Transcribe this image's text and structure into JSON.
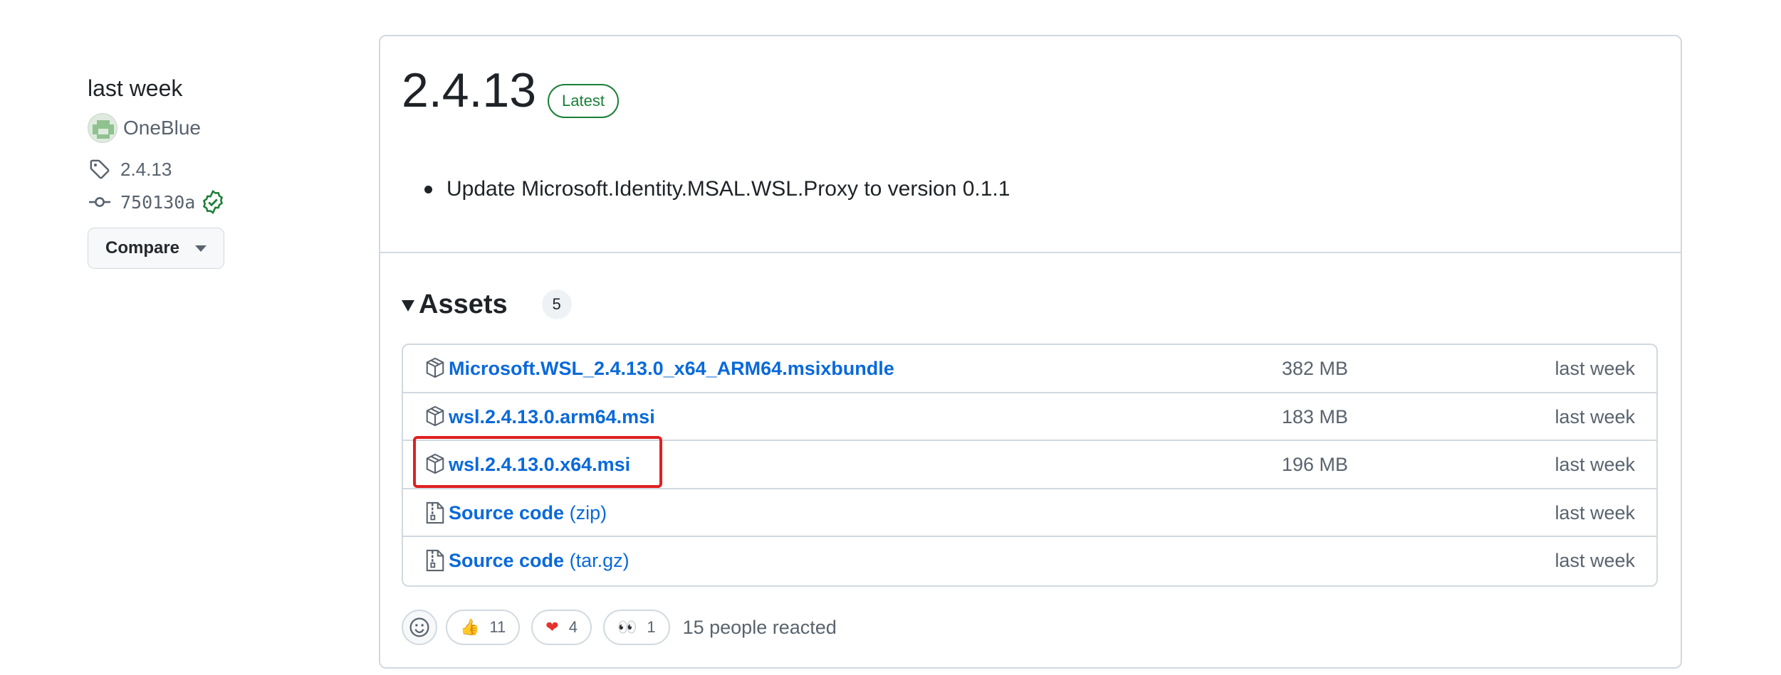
{
  "sidebar": {
    "date": "last week",
    "author": "OneBlue",
    "tag": "2.4.13",
    "commit": "750130a",
    "compare_label": "Compare"
  },
  "release": {
    "title": "2.4.13",
    "badge": "Latest",
    "notes": [
      "Update Microsoft.Identity.MSAL.WSL.Proxy to version 0.1.1"
    ]
  },
  "assets": {
    "title": "Assets",
    "count": "5",
    "items": [
      {
        "name": "Microsoft.WSL_2.4.13.0_x64_ARM64.msixbundle",
        "suffix": "",
        "size": "382 MB",
        "date": "last week",
        "icon": "package-icon"
      },
      {
        "name": "wsl.2.4.13.0.arm64.msi",
        "suffix": "",
        "size": "183 MB",
        "date": "last week",
        "icon": "package-icon"
      },
      {
        "name": "wsl.2.4.13.0.x64.msi",
        "suffix": "",
        "size": "196 MB",
        "date": "last week",
        "icon": "package-icon"
      },
      {
        "name": "Source code",
        "suffix": "(zip)",
        "size": "",
        "date": "last week",
        "icon": "file-zip-icon"
      },
      {
        "name": "Source code",
        "suffix": "(tar.gz)",
        "size": "",
        "date": "last week",
        "icon": "file-zip-icon"
      }
    ]
  },
  "reactions": {
    "items": [
      {
        "emoji": "👍",
        "count": "11",
        "icon": "thumbs-up-icon"
      },
      {
        "emoji": "❤",
        "count": "4",
        "icon": "heart-icon"
      },
      {
        "emoji": "👀",
        "count": "1",
        "icon": "eyes-icon"
      }
    ],
    "summary": "15 people reacted"
  },
  "colors": {
    "link": "#0969da",
    "latest_green": "#1a7f37",
    "highlight_red": "#e02020",
    "border": "#d1d9e0",
    "muted_text": "#59636e"
  }
}
